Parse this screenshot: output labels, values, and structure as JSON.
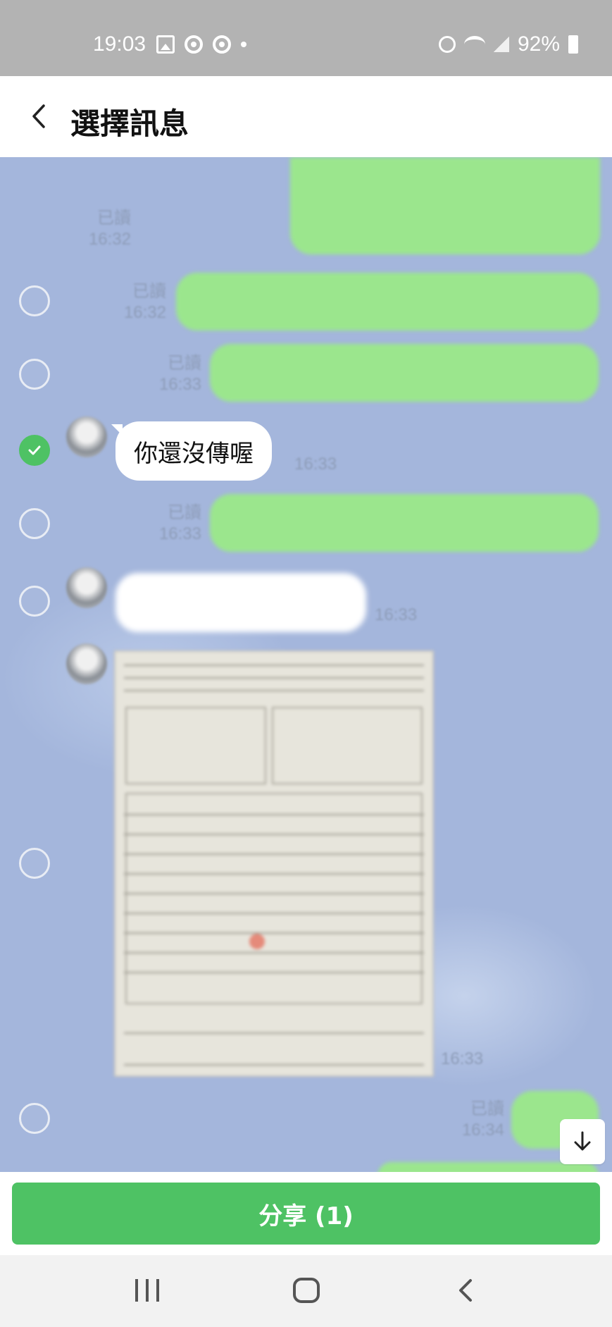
{
  "status_bar": {
    "time": "19:03",
    "battery": "92%",
    "left_icons": [
      "gallery-icon",
      "chrome-icon",
      "chrome-icon",
      "dot-icon"
    ],
    "right_icons": [
      "alarm-icon",
      "wifi-icon",
      "signal-icon",
      "battery-icon"
    ]
  },
  "header": {
    "title": "選擇訊息",
    "back_icon": "chevron-left-icon"
  },
  "messages": [
    {
      "read": "已讀",
      "time": "16:32"
    },
    {
      "read": "已讀",
      "time": "16:32"
    },
    {
      "read": "已讀",
      "time": "16:33"
    },
    {
      "text": "你還沒傳喔",
      "time": "16:33",
      "selected": true
    },
    {
      "read": "已讀",
      "time": "16:33"
    },
    {
      "time": "16:33"
    },
    {
      "time": "16:33",
      "type": "image"
    },
    {
      "read": "已讀",
      "time": "16:34"
    }
  ],
  "scroll_down_icon": "arrow-down-icon",
  "share_button": "分享 (1)",
  "nav": {
    "recent_icon": "recent-apps-icon",
    "home_icon": "home-icon",
    "back_icon": "back-icon"
  },
  "colors": {
    "chat_bg": "#a4b6dc",
    "green_bubble": "#9be68d",
    "accent": "#4ec264",
    "status_bar": "#b3b3b3"
  }
}
